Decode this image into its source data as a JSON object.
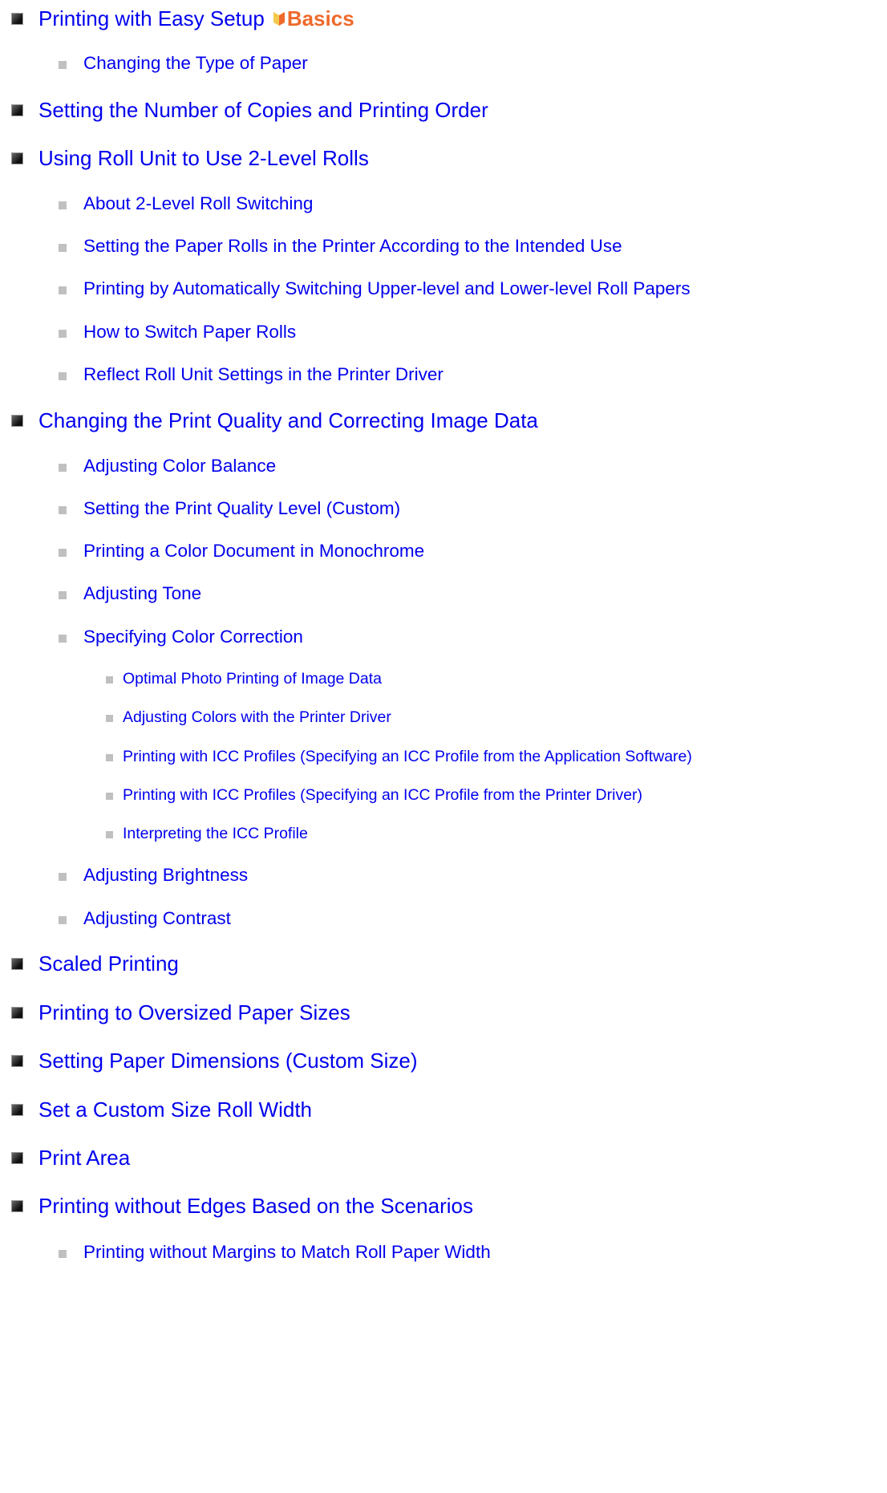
{
  "toc": {
    "basics_badge": "Basics",
    "items": [
      {
        "label": "Printing with Easy Setup"
      },
      {
        "label": "Changing the Type of Paper"
      },
      {
        "label": "Setting the Number of Copies and Printing Order"
      },
      {
        "label": "Using Roll Unit to Use 2-Level Rolls"
      },
      {
        "label": "About 2-Level Roll Switching"
      },
      {
        "label": "Setting the Paper Rolls in the Printer According to the Intended Use"
      },
      {
        "label": "Printing by Automatically Switching Upper-level and Lower-level Roll Papers"
      },
      {
        "label": "How to Switch Paper Rolls"
      },
      {
        "label": "Reflect Roll Unit Settings in the Printer Driver"
      },
      {
        "label": "Changing the Print Quality and Correcting Image Data"
      },
      {
        "label": "Adjusting Color Balance"
      },
      {
        "label": "Setting the Print Quality Level (Custom)"
      },
      {
        "label": "Printing a Color Document in Monochrome"
      },
      {
        "label": "Adjusting Tone"
      },
      {
        "label": "Specifying Color Correction"
      },
      {
        "label": "Optimal Photo Printing of Image Data"
      },
      {
        "label": "Adjusting Colors with the Printer Driver"
      },
      {
        "label": "Printing with ICC Profiles (Specifying an ICC Profile from the Application Software)"
      },
      {
        "label": "Printing with ICC Profiles (Specifying an ICC Profile from the Printer Driver)"
      },
      {
        "label": "Interpreting the ICC Profile"
      },
      {
        "label": "Adjusting Brightness"
      },
      {
        "label": "Adjusting Contrast"
      },
      {
        "label": "Scaled Printing"
      },
      {
        "label": "Printing to Oversized Paper Sizes"
      },
      {
        "label": "Setting Paper Dimensions (Custom Size)"
      },
      {
        "label": "Set a Custom Size Roll Width"
      },
      {
        "label": "Print Area"
      },
      {
        "label": "Printing without Edges Based on the Scenarios"
      },
      {
        "label": "Printing without Margins to Match Roll Paper Width"
      }
    ]
  }
}
